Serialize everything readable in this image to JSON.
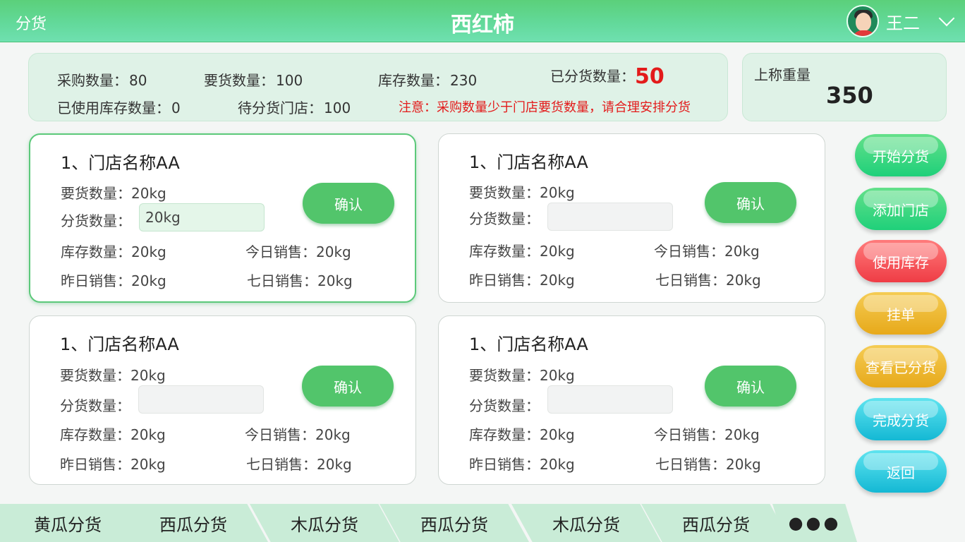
{
  "header": {
    "breadcrumb": "分货",
    "title": "西红柿",
    "user_name": "王二"
  },
  "summary": {
    "purchase_label": "采购数量：",
    "purchase_value": "80",
    "demand_label": "要货数量：",
    "demand_value": "100",
    "stock_label": "库存数量：",
    "stock_value": "230",
    "distributed_label": "已分货数量：",
    "distributed_value": "50",
    "used_stock_label": "已使用库存数量：",
    "used_stock_value": "0",
    "pending_label": "待分货门店：",
    "pending_value": "100",
    "notice": "注意：采购数量少于门店要货数量，请合理安排分货"
  },
  "scale": {
    "label": "上称重量",
    "value": "350"
  },
  "stores": [
    {
      "name": "1、门店名称AA",
      "demand": "要货数量：20kg",
      "dist_label": "分货数量：",
      "dist_value": "20kg",
      "stock": "库存数量：20kg",
      "today": "今日销售：20kg",
      "yesterday": "昨日销售：20kg",
      "week": "七日销售：20kg",
      "confirm": "确认"
    },
    {
      "name": "1、门店名称AA",
      "demand": "要货数量：20kg",
      "dist_label": "分货数量：",
      "dist_value": "",
      "stock": "库存数量：20kg",
      "today": "今日销售：20kg",
      "yesterday": "昨日销售：20kg",
      "week": "七日销售：20kg",
      "confirm": "确认"
    },
    {
      "name": "1、门店名称AA",
      "demand": "要货数量：20kg",
      "dist_label": "分货数量：",
      "dist_value": "",
      "stock": "库存数量：20kg",
      "today": "今日销售：20kg",
      "yesterday": "昨日销售：20kg",
      "week": "七日销售：20kg",
      "confirm": "确认"
    },
    {
      "name": "1、门店名称AA",
      "demand": "要货数量：20kg",
      "dist_label": "分货数量：",
      "dist_value": "",
      "stock": "库存数量：20kg",
      "today": "今日销售：20kg",
      "yesterday": "昨日销售：20kg",
      "week": "七日销售：20kg",
      "confirm": "确认"
    }
  ],
  "actions": {
    "start": "开始分货",
    "add_store": "添加门店",
    "use_stock": "使用库存",
    "hold": "挂单",
    "view_distributed": "查看已分货",
    "finish": "完成分货",
    "back": "返回"
  },
  "tabs": [
    "黄瓜分货",
    "西瓜分货",
    "木瓜分货",
    "西瓜分货",
    "木瓜分货",
    "西瓜分货"
  ],
  "more": "●●●",
  "colors": {
    "primary_green": "#52c56b",
    "header_green": "#5bd07a",
    "alert_red": "#e31b1b",
    "panel_bg": "#dff2e7"
  }
}
